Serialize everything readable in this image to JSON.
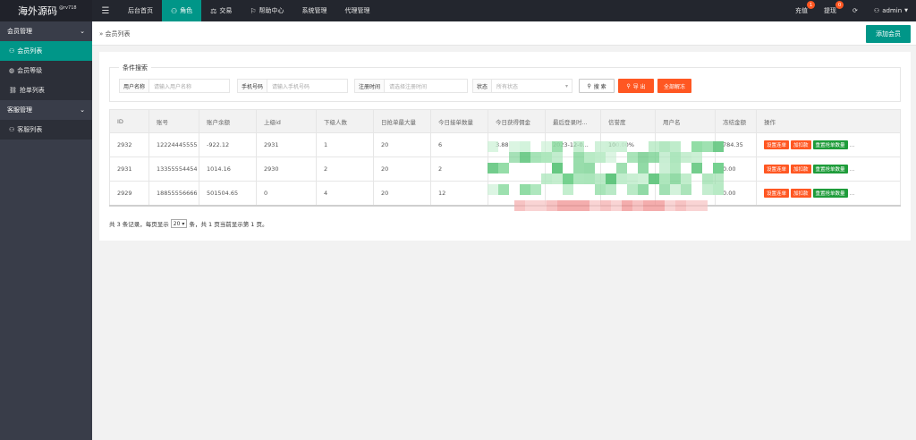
{
  "app": {
    "logo": "海外源码",
    "logo_sub": "@rv718"
  },
  "topbar": {
    "menu_icon": "menu-icon",
    "nav": [
      {
        "label": "后台首页",
        "icon": ""
      },
      {
        "label": "角色",
        "icon": "user-icon",
        "active": true
      },
      {
        "label": "交易",
        "icon": "scale-icon"
      },
      {
        "label": "帮助中心",
        "icon": "flag-icon"
      },
      {
        "label": "系统管理",
        "icon": ""
      },
      {
        "label": "代理管理",
        "icon": ""
      }
    ],
    "recharge": {
      "label": "充值",
      "badge": "1"
    },
    "withdraw": {
      "label": "提现",
      "badge": "0"
    },
    "refresh_icon": "refresh-icon",
    "user": "admin"
  },
  "sidebar": {
    "groups": [
      {
        "label": "会员管理",
        "items": [
          {
            "label": "会员列表",
            "icon": "user-icon",
            "active": true
          },
          {
            "label": "会员等级",
            "icon": "globe-icon"
          },
          {
            "label": "抢单列表",
            "icon": "link-icon"
          }
        ]
      },
      {
        "label": "客服管理",
        "items": [
          {
            "label": "客服列表",
            "icon": "users-icon"
          }
        ]
      }
    ]
  },
  "header": {
    "breadcrumb": "会员列表",
    "add_button": "添加会员"
  },
  "filter": {
    "legend": "条件搜索",
    "username_label": "用户名称",
    "username_placeholder": "请输入用户名称",
    "phone_label": "手机号码",
    "phone_placeholder": "请输入手机号码",
    "regtime_label": "注册时间",
    "regtime_placeholder": "请选择注册时间",
    "status_label": "状态",
    "status_value": "所有状态",
    "search_button": "搜 索",
    "export_button": "导 出",
    "unlock_button": "全部解冻"
  },
  "table": {
    "headers": [
      "ID",
      "账号",
      "账户余额",
      "上级id",
      "下级人数",
      "日抢单最大量",
      "今日接单数量",
      "今日获得佣金",
      "最后登录时...",
      "信誉度",
      "用户名",
      "冻结金额",
      "操作"
    ],
    "rows": [
      {
        "cells": [
          "2932",
          "12224445555",
          "-922.12",
          "2931",
          "1",
          "20",
          "6",
          "3.88",
          "2023-12-0...",
          "100.00%",
          "",
          "784.35"
        ]
      },
      {
        "cells": [
          "2931",
          "13355554454",
          "1014.16",
          "2930",
          "2",
          "20",
          "2",
          "",
          "",
          "",
          "",
          "0.00"
        ]
      },
      {
        "cells": [
          "2929",
          "18855556666",
          "501504.65",
          "0",
          "4",
          "20",
          "12",
          "",
          "",
          "",
          "",
          "0.00"
        ]
      }
    ],
    "actions": {
      "set_order": "设置连单",
      "add_deduct": "加扣款",
      "reset": "重置抢单数量",
      "more": "..."
    }
  },
  "pager": {
    "prefix": "共 3 条记录，每页显示",
    "page_size": "20",
    "suffix": "条，共 1 页当前显示第 1 页。"
  },
  "colors": {
    "accent": "#009688",
    "orange": "#ff5722",
    "green": "#1e9c3a",
    "topbar": "#23262e",
    "sidebar": "#393d49"
  }
}
